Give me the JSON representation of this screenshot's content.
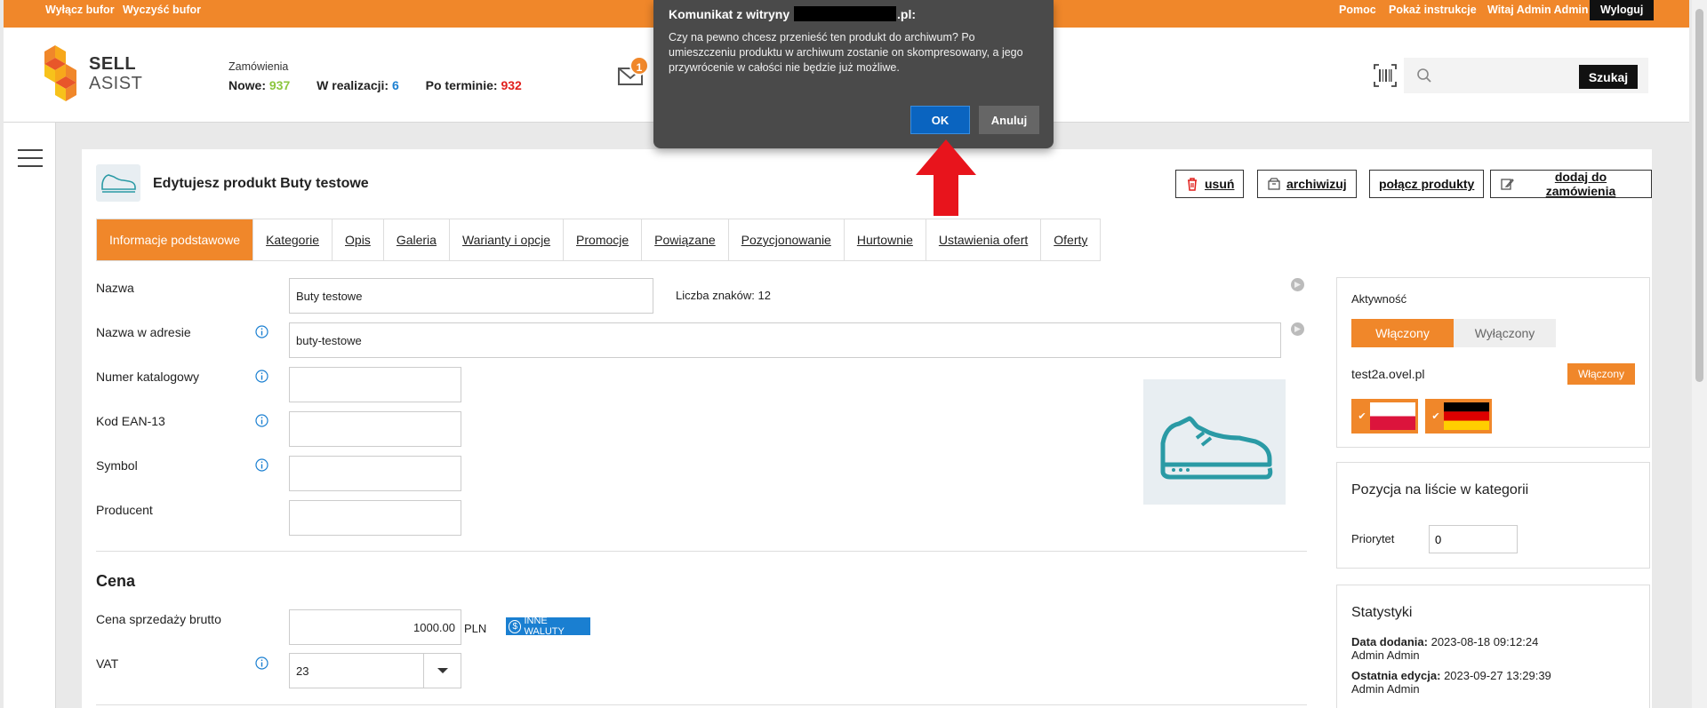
{
  "topbar": {
    "cache_off": "Wyłącz bufor",
    "cache_clear": "Wyczyść bufor",
    "help": "Pomoc",
    "instructions": "Pokaż instrukcje",
    "greeting": "Witaj Admin Admin",
    "logout": "Wyloguj"
  },
  "header": {
    "logo_line1": "SELL",
    "logo_line2": "ASIST",
    "orders_title": "Zamówienia",
    "new_label": "Nowe:",
    "new_value": "937",
    "inprogress_label": "W realizacji:",
    "inprogress_value": "6",
    "overdue_label": "Po terminie:",
    "overdue_value": "932",
    "mail_badge": "1",
    "search_placeholder": "",
    "search_button": "Szukaj"
  },
  "product": {
    "title": "Edytujesz produkt Buty testowe",
    "actions": {
      "delete": "usuń",
      "archive": "archiwizuj",
      "merge": "połącz produkty",
      "add_order": "dodaj do zamówienia"
    }
  },
  "tabs": [
    {
      "label": "Informacje podstawowe",
      "active": true
    },
    {
      "label": "Kategorie"
    },
    {
      "label": "Opis"
    },
    {
      "label": "Galeria"
    },
    {
      "label": "Warianty i opcje"
    },
    {
      "label": "Promocje"
    },
    {
      "label": "Powiązane"
    },
    {
      "label": "Pozycjonowanie"
    },
    {
      "label": "Hurtownie"
    },
    {
      "label": "Ustawienia ofert"
    },
    {
      "label": "Oferty"
    }
  ],
  "form": {
    "name_label": "Nazwa",
    "name_value": "Buty testowe",
    "char_count": "Liczba znaków: 12",
    "url_label": "Nazwa w adresie",
    "url_value": "buty-testowe",
    "catalog_label": "Numer katalogowy",
    "catalog_value": "",
    "ean_label": "Kod EAN-13",
    "ean_value": "",
    "symbol_label": "Symbol",
    "symbol_value": "",
    "producer_label": "Producent",
    "producer_value": ""
  },
  "price": {
    "section_title": "Cena",
    "gross_label": "Cena sprzedaży brutto",
    "gross_value": "1000.00",
    "currency": "PLN",
    "other_currencies": "INNE WALUTY",
    "vat_label": "VAT",
    "vat_value": "23"
  },
  "activity": {
    "title": "Aktywność",
    "on": "Włączony",
    "off": "Wyłączony",
    "shop": "test2a.ovel.pl",
    "shop_status": "Włączony"
  },
  "position": {
    "title": "Pozycja na liście w kategorii",
    "priority_label": "Priorytet",
    "priority_value": "0"
  },
  "stats": {
    "title": "Statystyki",
    "added_label": "Data dodania:",
    "added_value": "2023-08-18 09:12:24",
    "added_by": "Admin Admin",
    "edited_label": "Ostatnia edycja:",
    "edited_value": "2023-09-27 13:29:39",
    "edited_by": "Admin Admin"
  },
  "dialog": {
    "title_prefix": "Komunikat z witryny",
    "title_suffix": ".pl:",
    "message": "Czy na pewno chcesz przenieść ten produkt do archiwum? Po umieszczeniu produktu w archiwum zostanie on skompresowany, a jego przywrócenie w całości nie będzie już możliwe.",
    "ok": "OK",
    "cancel": "Anuluj"
  },
  "colors": {
    "accent": "#f0872a",
    "new": "#8cc63e",
    "in_progress": "#1a7fd1",
    "overdue": "#e1201d"
  }
}
